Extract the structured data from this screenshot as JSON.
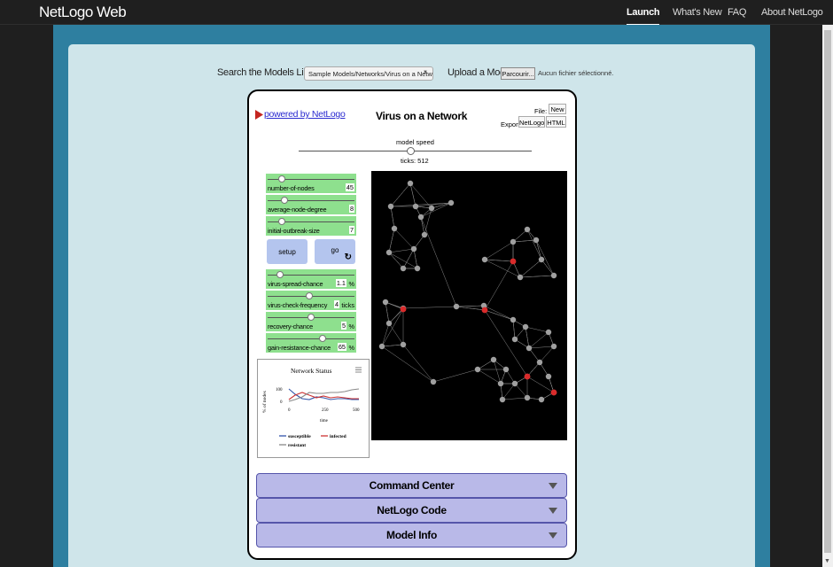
{
  "app": {
    "brand": "NetLogo Web"
  },
  "nav": [
    {
      "label": "Launch",
      "active": true
    },
    {
      "label": "What's New"
    },
    {
      "label": "FAQ"
    },
    {
      "label": "About NetLogo"
    }
  ],
  "toolbar": {
    "search_label": "Search the Models Library:",
    "selected_model": "Sample Models/Networks/Virus on a Network",
    "upload_label": "Upload a Model:",
    "browse_label": "Parcourir...",
    "no_file": "Aucun fichier sélectionné."
  },
  "model": {
    "powered_by": "powered by NetLogo",
    "title": "Virus on a Network",
    "file_label": "File:",
    "new_label": "New",
    "export_label": "Export:",
    "export_netlogo": "NetLogo",
    "export_html": "HTML",
    "speed_label": "model speed",
    "ticks_text": "ticks: 512"
  },
  "sliders": [
    {
      "label": "number-of-nodes",
      "value": "45",
      "unit": "",
      "level": 0.18
    },
    {
      "label": "average-node-degree",
      "value": "8",
      "unit": "",
      "level": 0.2
    },
    {
      "label": "initial-outbreak-size",
      "value": "7",
      "unit": "",
      "level": 0.18
    },
    {
      "label": "virus-spread-chance",
      "value": "1.1",
      "unit": "%",
      "level": 0.15
    },
    {
      "label": "virus-check-frequency",
      "value": "4",
      "unit": "ticks",
      "level": 0.47
    },
    {
      "label": "recovery-chance",
      "value": "5",
      "unit": "%",
      "level": 0.5
    },
    {
      "label": "gain-resistance-chance",
      "value": "65",
      "unit": "%",
      "level": 0.63
    }
  ],
  "buttons": {
    "setup": "setup",
    "go": "go",
    "go_icon": "forever-icon"
  },
  "plot": {
    "title": "Network Status",
    "ylabel": "% of nodes",
    "xlabel": "time",
    "yticks": [
      "100",
      "0"
    ],
    "xticks": [
      "0",
      "250",
      "500"
    ],
    "legend": [
      "susceptible",
      "infected",
      "resistant"
    ],
    "colors": {
      "susceptible": "#3355aa",
      "infected": "#cc3333",
      "resistant": "#888888"
    }
  },
  "world": {
    "background": "#000000",
    "node_color": "#a0a0a0",
    "infected_color": "#d92b2b"
  },
  "accordions": [
    "Command Center",
    "NetLogo Code",
    "Model Info"
  ]
}
